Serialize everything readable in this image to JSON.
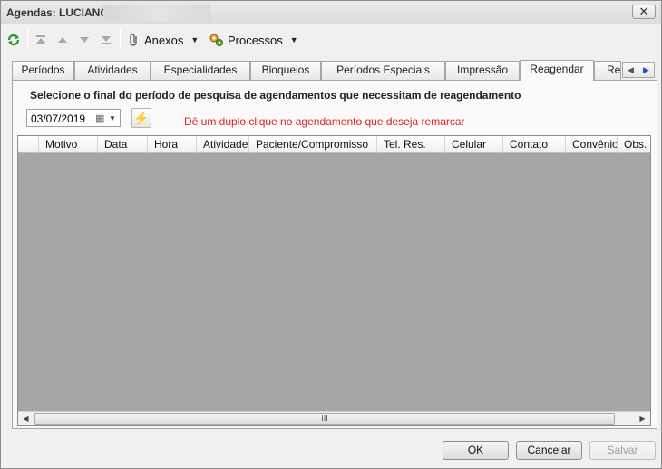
{
  "window": {
    "title": "Agendas: LUCIANO"
  },
  "toolbar": {
    "anexos_label": "Anexos",
    "processos_label": "Processos"
  },
  "tabs": [
    {
      "label": "Períodos"
    },
    {
      "label": "Atividades"
    },
    {
      "label": "Especialidades"
    },
    {
      "label": "Bloqueios"
    },
    {
      "label": "Períodos Especiais"
    },
    {
      "label": "Impressão"
    },
    {
      "label": "Reagendar"
    },
    {
      "label": "Re"
    }
  ],
  "active_tab": "Reagendar",
  "panel": {
    "instruction": "Selecione o final do período de pesquisa de agendamentos que necessitam de reagendamento",
    "date_value": "03/07/2019",
    "hint": "Dê um duplo clique no agendamento que deseja remarcar",
    "hint_color": "#e02020"
  },
  "grid": {
    "columns": [
      "Motivo",
      "Data",
      "Hora",
      "Atividade",
      "Paciente/Compromisso",
      "Tel. Res.",
      "Celular",
      "Contato",
      "Convênio",
      "Obs."
    ],
    "rows": []
  },
  "buttons": {
    "ok": "OK",
    "cancel": "Cancelar",
    "save": "Salvar"
  }
}
